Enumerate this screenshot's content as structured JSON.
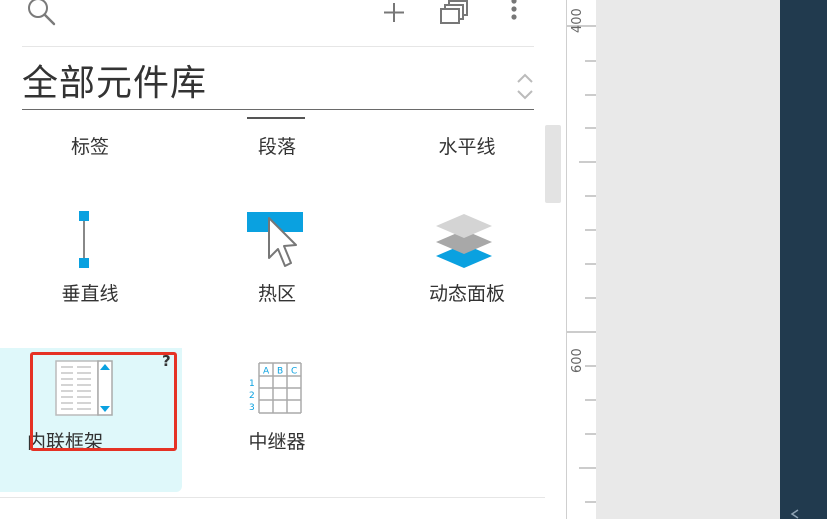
{
  "toolbar": {
    "search_icon": "search-icon",
    "add_icon": "plus-icon",
    "windows_icon": "stacked-windows-icon",
    "more_icon": "more-vertical-icon"
  },
  "library": {
    "selected": "全部元件库"
  },
  "widgets": [
    {
      "label": "标签",
      "icon": "label-icon"
    },
    {
      "label": "段落",
      "icon": "paragraph-icon"
    },
    {
      "label": "水平线",
      "icon": "horizontal-line-icon"
    },
    {
      "label": "垂直线",
      "icon": "vertical-line-icon"
    },
    {
      "label": "热区",
      "icon": "hotspot-icon"
    },
    {
      "label": "动态面板",
      "icon": "dynamic-panel-icon"
    },
    {
      "label": "内联框架",
      "icon": "inline-frame-icon",
      "help": "?"
    },
    {
      "label": "中继器",
      "icon": "repeater-icon"
    }
  ],
  "repeater_headers": [
    "A",
    "B",
    "C"
  ],
  "repeater_rows": [
    "1",
    "2",
    "3"
  ],
  "ruler": {
    "labels": [
      "400",
      "600"
    ]
  },
  "colors": {
    "accent_blue": "#0aa1e0",
    "highlight_red": "#e53224",
    "selection_bg": "#dff8fa",
    "dark_panel": "#213a4e"
  }
}
